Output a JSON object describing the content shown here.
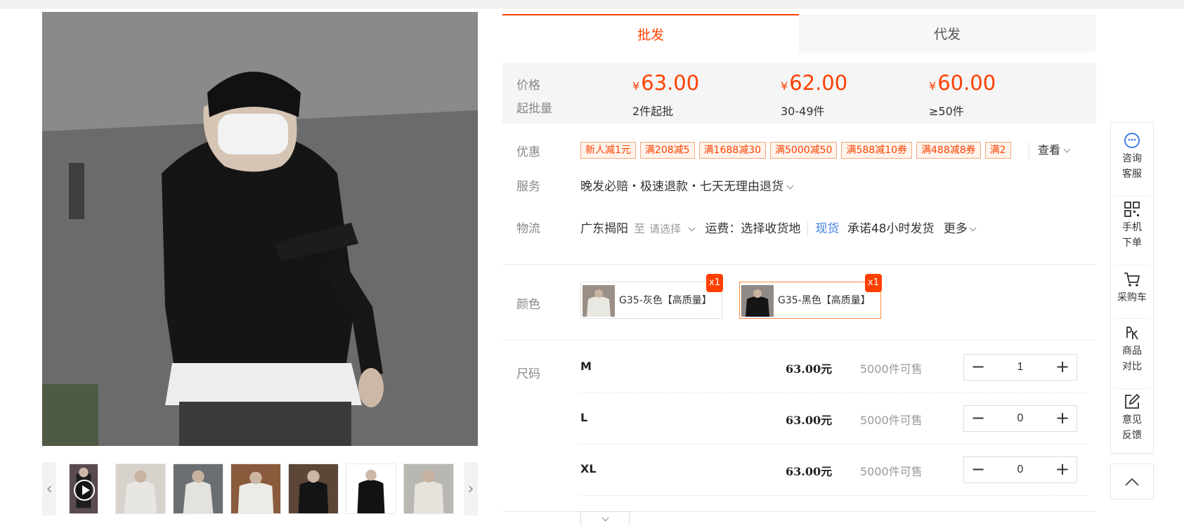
{
  "tabs": [
    {
      "label": "批发",
      "active": true
    },
    {
      "label": "代发",
      "active": false
    }
  ],
  "price": {
    "price_label": "价格",
    "min_label": "起批量",
    "currency": "¥",
    "tiers": [
      {
        "price": "63.00",
        "min": "2件起批"
      },
      {
        "price": "62.00",
        "min": "30-49件"
      },
      {
        "price": "60.00",
        "min": "≥50件"
      }
    ]
  },
  "promo": {
    "label": "优惠",
    "coupons": [
      "新人减1元",
      "满208减5",
      "满1688减30",
      "满5000减50",
      "满588减10券",
      "满488减8券",
      "满2"
    ],
    "view_more": "查看"
  },
  "service": {
    "label": "服务",
    "text": "晚发必赔・极速退款・七天无理由退货"
  },
  "logistics": {
    "label": "物流",
    "origin": "广东揭阳",
    "to": "至",
    "select": "请选择",
    "freight": "运费：选择收货地",
    "spot": "现货",
    "promise": "承诺48小时发货",
    "more": "更多"
  },
  "color": {
    "label": "颜色",
    "options": [
      {
        "name": "G35-灰色【高质量】",
        "badge": "x1",
        "selected": false
      },
      {
        "name": "G35-黑色【高质量】",
        "badge": "x1",
        "selected": true
      }
    ]
  },
  "size": {
    "label": "尺码",
    "rows": [
      {
        "name": "M",
        "price": "63.00元",
        "stock": "5000件可售",
        "qty": "1"
      },
      {
        "name": "L",
        "price": "63.00元",
        "stock": "5000件可售",
        "qty": "0"
      },
      {
        "name": "XL",
        "price": "63.00元",
        "stock": "5000件可售",
        "qty": "0"
      }
    ]
  },
  "sidebar": {
    "items": [
      {
        "label1": "咨询",
        "label2": "客服",
        "icon": "chat-icon"
      },
      {
        "label1": "手机",
        "label2": "下单",
        "icon": "qr-code-icon"
      },
      {
        "label1": "采购车",
        "label2": "",
        "icon": "cart-icon"
      },
      {
        "label1": "商品",
        "label2": "对比",
        "icon": "compare-icon"
      },
      {
        "label1": "意见",
        "label2": "反馈",
        "icon": "feedback-icon"
      }
    ]
  },
  "colors": {
    "accent": "#ff4000",
    "link": "#3f80e0"
  }
}
